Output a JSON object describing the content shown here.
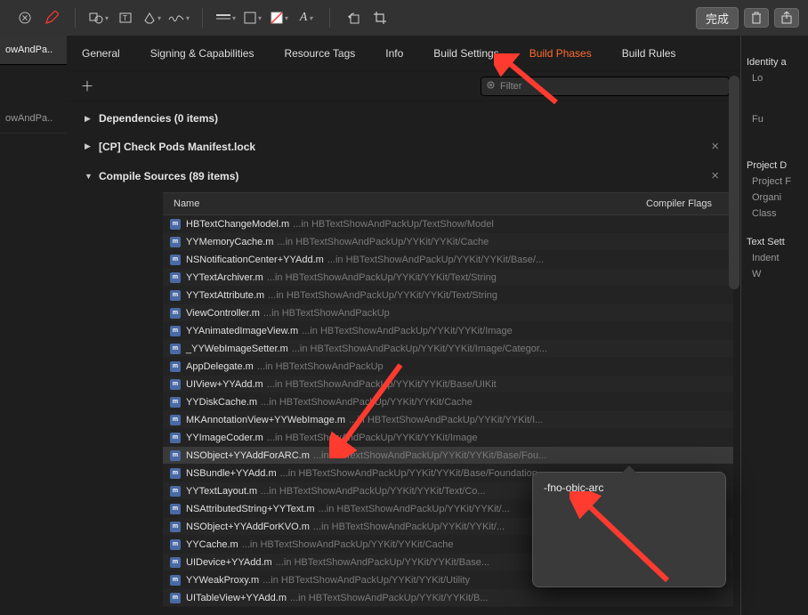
{
  "toolbar": {
    "done_label": "完成"
  },
  "left_sidebar": {
    "items": [
      "owAndPa..",
      "owAndPa.."
    ]
  },
  "tabs": [
    {
      "label": "General"
    },
    {
      "label": "Signing & Capabilities"
    },
    {
      "label": "Resource Tags"
    },
    {
      "label": "Info"
    },
    {
      "label": "Build Settings"
    },
    {
      "label": "Build Phases",
      "active": true
    },
    {
      "label": "Build Rules"
    }
  ],
  "filter_placeholder": "Filter",
  "phases": {
    "dependencies": "Dependencies (0 items)",
    "check_pods": "[CP] Check Pods Manifest.lock",
    "compile_sources": "Compile Sources (89 items)"
  },
  "columns": {
    "name": "Name",
    "flags": "Compiler Flags"
  },
  "files": [
    {
      "name": "HBTextChangeModel.m",
      "path": "...in HBTextShowAndPackUp/TextShow/Model"
    },
    {
      "name": "YYMemoryCache.m",
      "path": "...in HBTextShowAndPackUp/YYKit/YYKit/Cache"
    },
    {
      "name": "NSNotificationCenter+YYAdd.m",
      "path": "...in HBTextShowAndPackUp/YYKit/YYKit/Base/..."
    },
    {
      "name": "YYTextArchiver.m",
      "path": "...in HBTextShowAndPackUp/YYKit/YYKit/Text/String"
    },
    {
      "name": "YYTextAttribute.m",
      "path": "...in HBTextShowAndPackUp/YYKit/YYKit/Text/String"
    },
    {
      "name": "ViewController.m",
      "path": "...in HBTextShowAndPackUp"
    },
    {
      "name": "YYAnimatedImageView.m",
      "path": "...in HBTextShowAndPackUp/YYKit/YYKit/Image"
    },
    {
      "name": "_YYWebImageSetter.m",
      "path": "...in HBTextShowAndPackUp/YYKit/YYKit/Image/Categor..."
    },
    {
      "name": "AppDelegate.m",
      "path": "...in HBTextShowAndPackUp"
    },
    {
      "name": "UIView+YYAdd.m",
      "path": "...in HBTextShowAndPackUp/YYKit/YYKit/Base/UIKit"
    },
    {
      "name": "YYDiskCache.m",
      "path": "...in HBTextShowAndPackUp/YYKit/YYKit/Cache"
    },
    {
      "name": "MKAnnotationView+YYWebImage.m",
      "path": "...in HBTextShowAndPackUp/YYKit/YYKit/I..."
    },
    {
      "name": "YYImageCoder.m",
      "path": "...in HBTextShowAndPackUp/YYKit/YYKit/Image"
    },
    {
      "name": "NSObject+YYAddForARC.m",
      "path": "...in HBTextShowAndPackUp/YYKit/YYKit/Base/Fou...",
      "selected": true
    },
    {
      "name": "NSBundle+YYAdd.m",
      "path": "...in HBTextShowAndPackUp/YYKit/YYKit/Base/Foundation"
    },
    {
      "name": "YYTextLayout.m",
      "path": "...in HBTextShowAndPackUp/YYKit/YYKit/Text/Co..."
    },
    {
      "name": "NSAttributedString+YYText.m",
      "path": "...in HBTextShowAndPackUp/YYKit/YYKit/..."
    },
    {
      "name": "NSObject+YYAddForKVO.m",
      "path": "...in HBTextShowAndPackUp/YYKit/YYKit/..."
    },
    {
      "name": "YYCache.m",
      "path": "...in HBTextShowAndPackUp/YYKit/YYKit/Cache"
    },
    {
      "name": "UIDevice+YYAdd.m",
      "path": "...in HBTextShowAndPackUp/YYKit/YYKit/Base..."
    },
    {
      "name": "YYWeakProxy.m",
      "path": "...in HBTextShowAndPackUp/YYKit/YYKit/Utility"
    },
    {
      "name": "UITableView+YYAdd.m",
      "path": "...in HBTextShowAndPackUp/YYKit/YYKit/B..."
    }
  ],
  "popover_value": "-fno-objc-arc",
  "right_panel": {
    "section1": "Identity a",
    "items1": [
      "Lo",
      "Fu"
    ],
    "section2": "Project D",
    "items2": [
      "Project F",
      "Organi",
      "Class"
    ],
    "section3": "Text Sett",
    "items3": [
      "Indent",
      "W"
    ]
  }
}
